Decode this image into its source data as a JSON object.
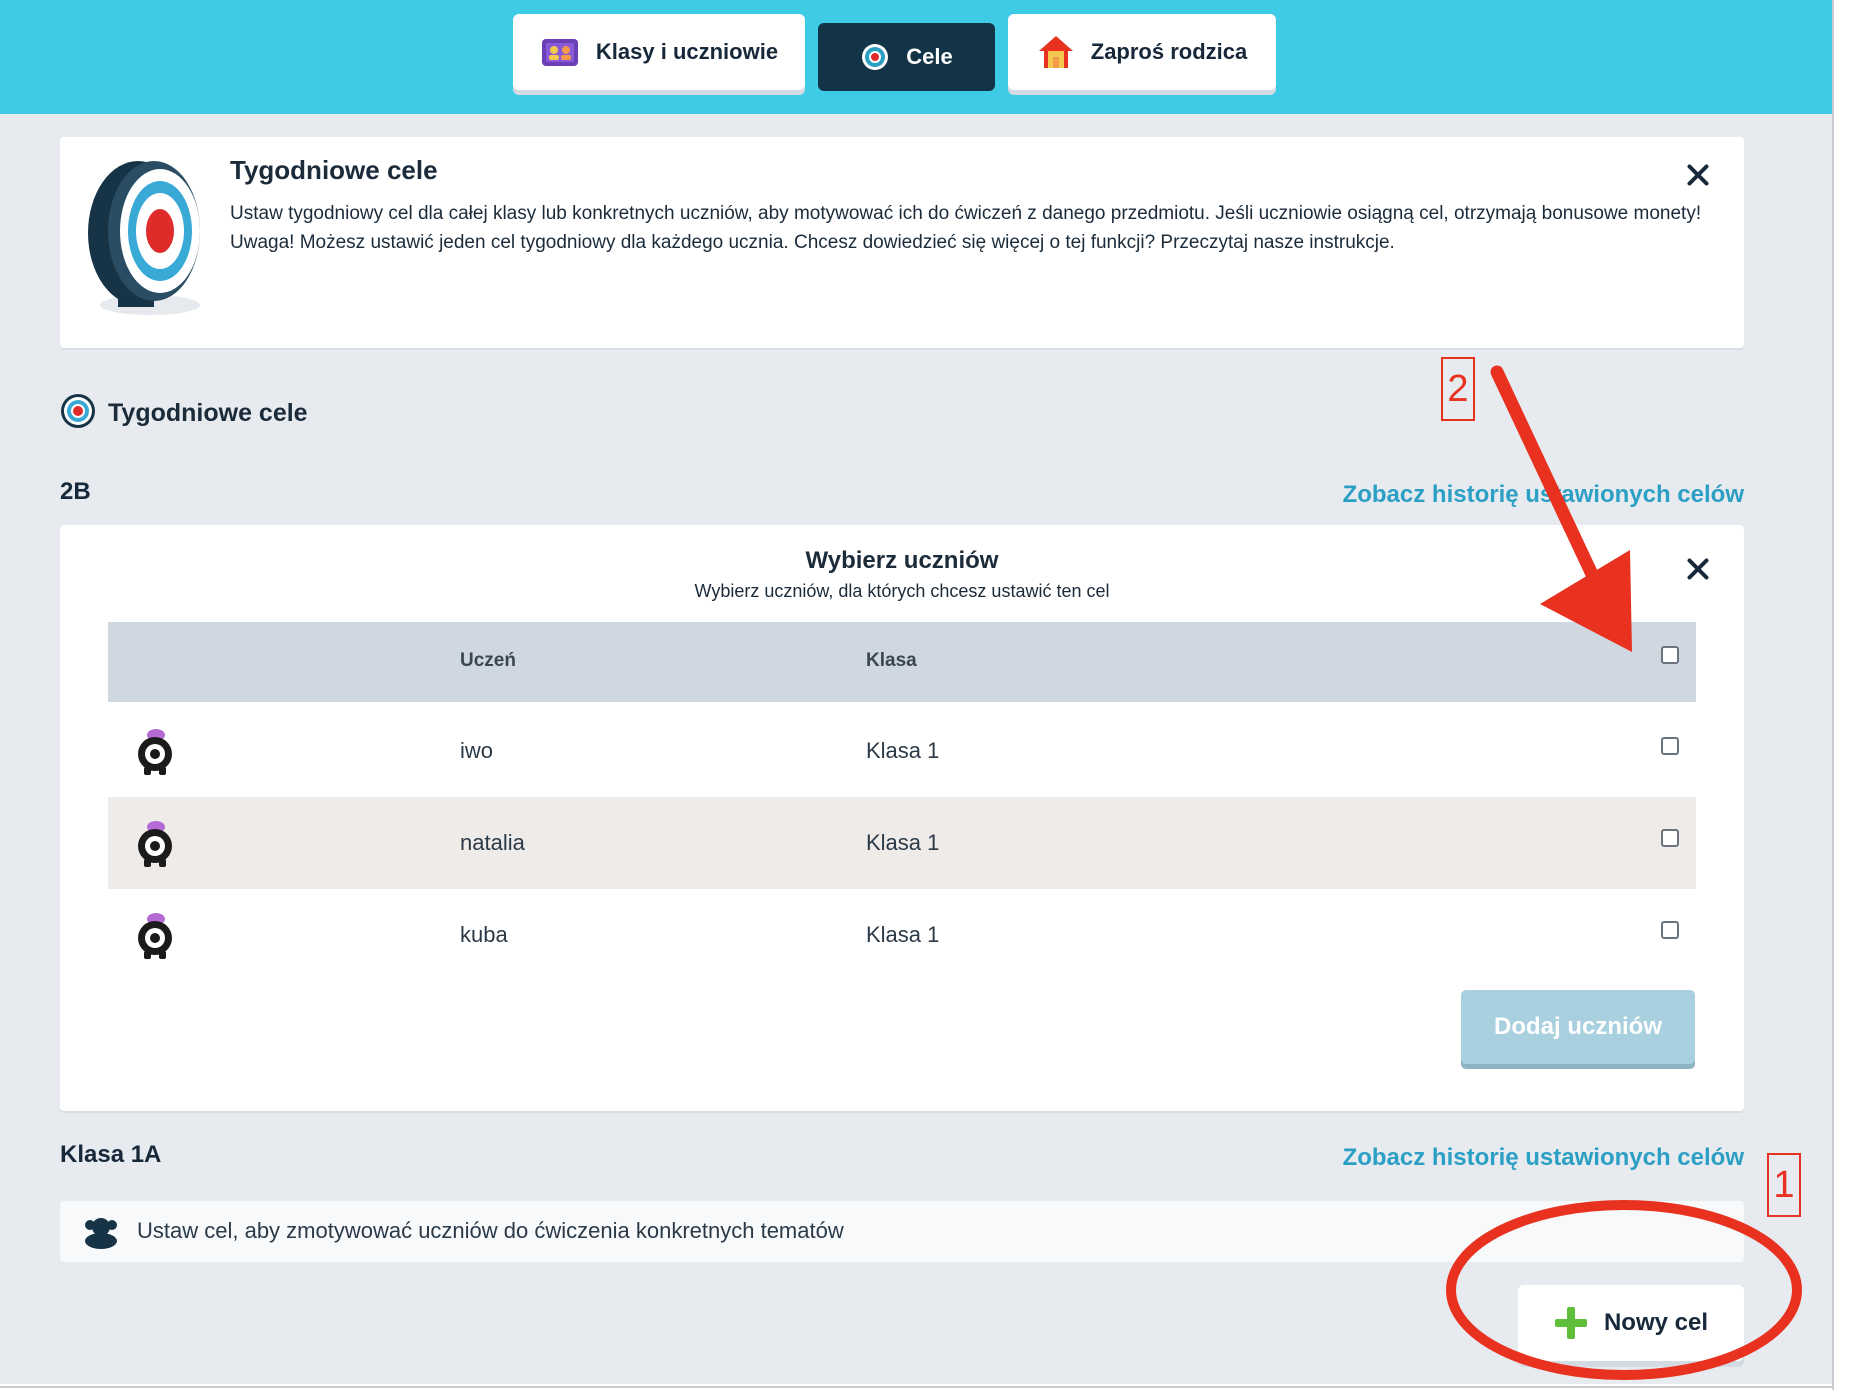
{
  "tabs": [
    {
      "label": "Klasy i uczniowie",
      "icon": "students-card-icon",
      "active": false
    },
    {
      "label": "Cele",
      "icon": "target-icon",
      "active": true
    },
    {
      "label": "Zaproś rodzica",
      "icon": "house-icon",
      "active": false
    }
  ],
  "info": {
    "title": "Tygodniowe cele",
    "text": "Ustaw tygodniowy cel dla całej klasy lub konkretnych uczniów, aby motywować ich do ćwiczeń z danego przedmiotu. Jeśli uczniowie osiągną cel, otrzymają bonusowe monety! Uwaga! Możesz ustawić jeden cel tygodniowy dla każdego ucznia. Chcesz dowiedzieć się więcej o tej funkcji? Przeczytaj nasze instrukcje."
  },
  "section_title": "Tygodniowe cele",
  "class_2b": {
    "name": "2B",
    "history_link": "Zobacz historię ustawionych celów"
  },
  "select_students": {
    "title": "Wybierz uczniów",
    "subtitle": "Wybierz uczniów, dla których chcesz ustawić ten cel",
    "col_student": "Uczeń",
    "col_class": "Klasa",
    "rows": [
      {
        "name": "iwo",
        "klasa": "Klasa 1",
        "checked": false
      },
      {
        "name": "natalia",
        "klasa": "Klasa 1",
        "checked": false
      },
      {
        "name": "kuba",
        "klasa": "Klasa 1",
        "checked": false
      }
    ],
    "add_button": "Dodaj uczniów"
  },
  "class_1a": {
    "name": "Klasa 1A",
    "history_link": "Zobacz historię ustawionych celów",
    "notice": "Ustaw cel, aby zmotywować uczniów do ćwiczenia konkretnych tematów"
  },
  "new_goal_button": "Nowy cel",
  "annotations": {
    "one": "1",
    "two": "2",
    "color": "#e8321f"
  },
  "colors": {
    "header": "#3ecbe6",
    "active_tab": "#123446",
    "link": "#2c9fc4",
    "plus": "#5fbf3a"
  }
}
